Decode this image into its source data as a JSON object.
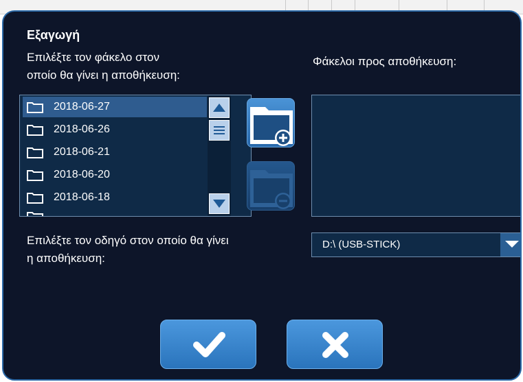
{
  "dialog": {
    "title": "Εξαγωγή",
    "select_folder_line1": "Επιλέξτε τον φάκελο στον",
    "select_folder_line2": "οποίο θα γίνει η αποθήκευση:",
    "folders_to_save_label": "Φάκελοι προς αποθήκευση:",
    "select_drive_line1": "Επιλέξτε τον οδηγό στον οποίο θα γίνει",
    "select_drive_line2": "η αποθήκευση:"
  },
  "folder_list": {
    "items": [
      {
        "label": "2018-06-27",
        "selected": true
      },
      {
        "label": "2018-06-26",
        "selected": false
      },
      {
        "label": "2018-06-21",
        "selected": false
      },
      {
        "label": "2018-06-20",
        "selected": false
      },
      {
        "label": "2018-06-18",
        "selected": false
      }
    ]
  },
  "drive_select": {
    "value": "D:\\ (USB-STICK)"
  },
  "icons": {
    "add": "folder-add-icon",
    "remove": "folder-remove-icon",
    "confirm": "checkmark-icon",
    "cancel": "close-icon"
  },
  "colors": {
    "dialog_bg": "#0d1529",
    "accent": "#2c6aa8",
    "button": "#3a85cf"
  }
}
